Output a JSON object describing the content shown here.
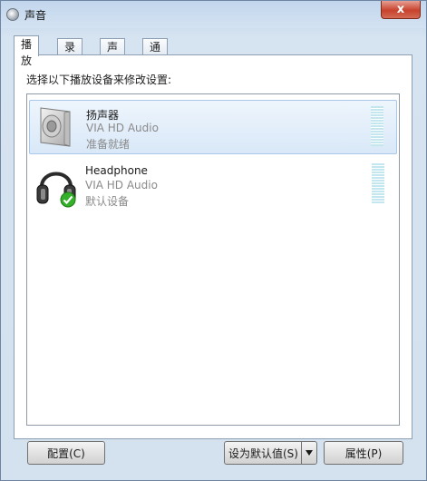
{
  "window": {
    "title": "声音",
    "close_label": "x"
  },
  "tabs": [
    {
      "label": "播放",
      "active": true
    },
    {
      "label": "录制",
      "active": false
    },
    {
      "label": "声音",
      "active": false
    },
    {
      "label": "通信",
      "active": false
    }
  ],
  "instruction": "选择以下播放设备来修改设置:",
  "devices": [
    {
      "name": "扬声器",
      "driver": "VIA HD Audio",
      "status": "准备就绪",
      "icon": "speaker-icon",
      "selected": true
    },
    {
      "name": "Headphone",
      "driver": "VIA HD Audio",
      "status": "默认设备",
      "icon": "headphone-icon",
      "default_badge": "check-icon",
      "selected": false
    }
  ],
  "buttons": {
    "configure": "配置(C)",
    "set_default": "设为默认值(S)",
    "properties": "属性(P)"
  },
  "colors": {
    "selection": "#d9e8f8",
    "accent_check": "#35b02a"
  }
}
